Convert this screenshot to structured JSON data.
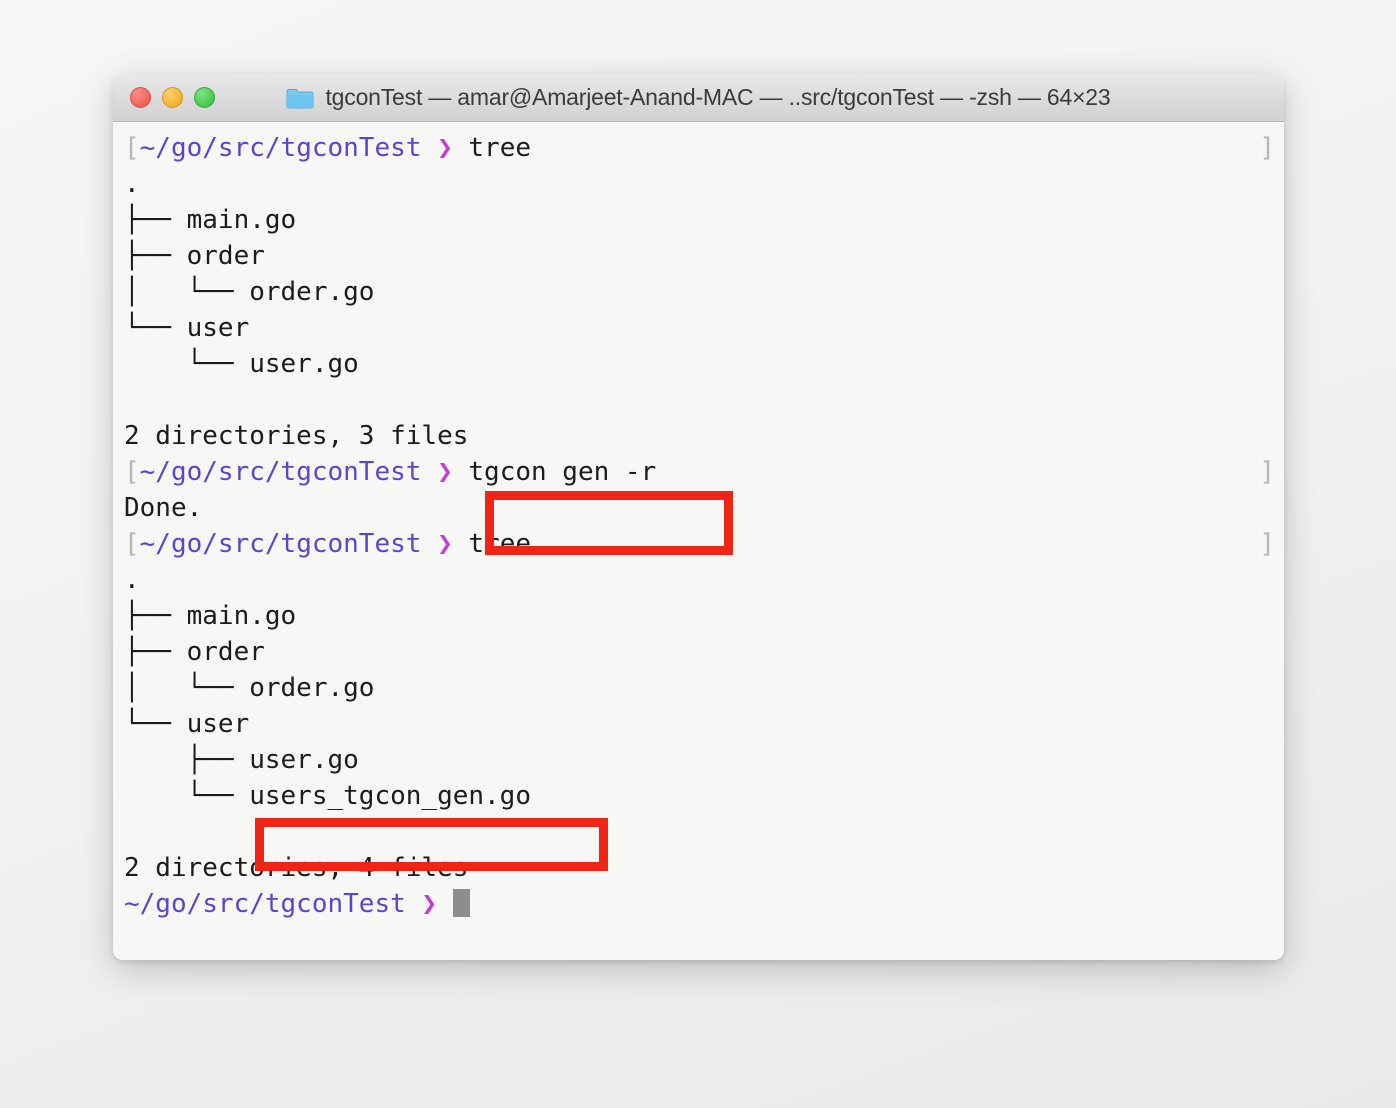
{
  "window": {
    "title": "tgconTest — amar@Amarjeet-Anand-MAC — ..src/tgconTest — -zsh — 64×23",
    "folder_icon": "folder-icon",
    "controls": {
      "close_label": "close",
      "minimize_label": "minimize",
      "zoom_label": "zoom"
    },
    "colors": {
      "close": "#ef6054",
      "minimize": "#efb230",
      "zoom": "#44c94c",
      "folder": "#6bc5ee",
      "titlebar": "#dcdcdc",
      "terminal_bg": "#f7f7f5",
      "prompt_path": "#5b45cf",
      "prompt_chevron": "#c33ed2",
      "bracket": "#b6b6b6",
      "cursor": "#8d8d8d",
      "annotation": "#f02516"
    }
  },
  "terminal": {
    "prompt": {
      "open_bracket": "[",
      "path": "~/go/src/tgconTest",
      "chevron": "❯",
      "close_bracket": "]"
    },
    "cursor": "█",
    "lines": [
      {
        "kind": "prompt",
        "command": "tree",
        "bracketed": true
      },
      {
        "kind": "output",
        "text": "."
      },
      {
        "kind": "output",
        "text": "├── main.go"
      },
      {
        "kind": "output",
        "text": "├── order"
      },
      {
        "kind": "output",
        "text": "│   └── order.go"
      },
      {
        "kind": "output",
        "text": "└── user"
      },
      {
        "kind": "output",
        "text": "    └── user.go"
      },
      {
        "kind": "output",
        "text": ""
      },
      {
        "kind": "output",
        "text": "2 directories, 3 files"
      },
      {
        "kind": "prompt",
        "command": "tgcon gen -r",
        "bracketed": true,
        "highlighted": true
      },
      {
        "kind": "output",
        "text": "Done."
      },
      {
        "kind": "prompt",
        "command": "tree",
        "bracketed": true
      },
      {
        "kind": "output",
        "text": "."
      },
      {
        "kind": "output",
        "text": "├── main.go"
      },
      {
        "kind": "output",
        "text": "├── order"
      },
      {
        "kind": "output",
        "text": "│   └── order.go"
      },
      {
        "kind": "output",
        "text": "└── user"
      },
      {
        "kind": "output",
        "text": "    ├── user.go"
      },
      {
        "kind": "output",
        "text": "    └── users_tgcon_gen.go",
        "highlighted": true
      },
      {
        "kind": "output",
        "text": ""
      },
      {
        "kind": "output",
        "text": "2 directories, 4 files"
      },
      {
        "kind": "prompt",
        "command": "",
        "bracketed": false,
        "cursor": true
      }
    ]
  },
  "annotations": [
    {
      "name": "annotation-box-command",
      "target": "tgcon gen -r"
    },
    {
      "name": "annotation-box-generated-file",
      "target": "users_tgcon_gen.go"
    }
  ]
}
